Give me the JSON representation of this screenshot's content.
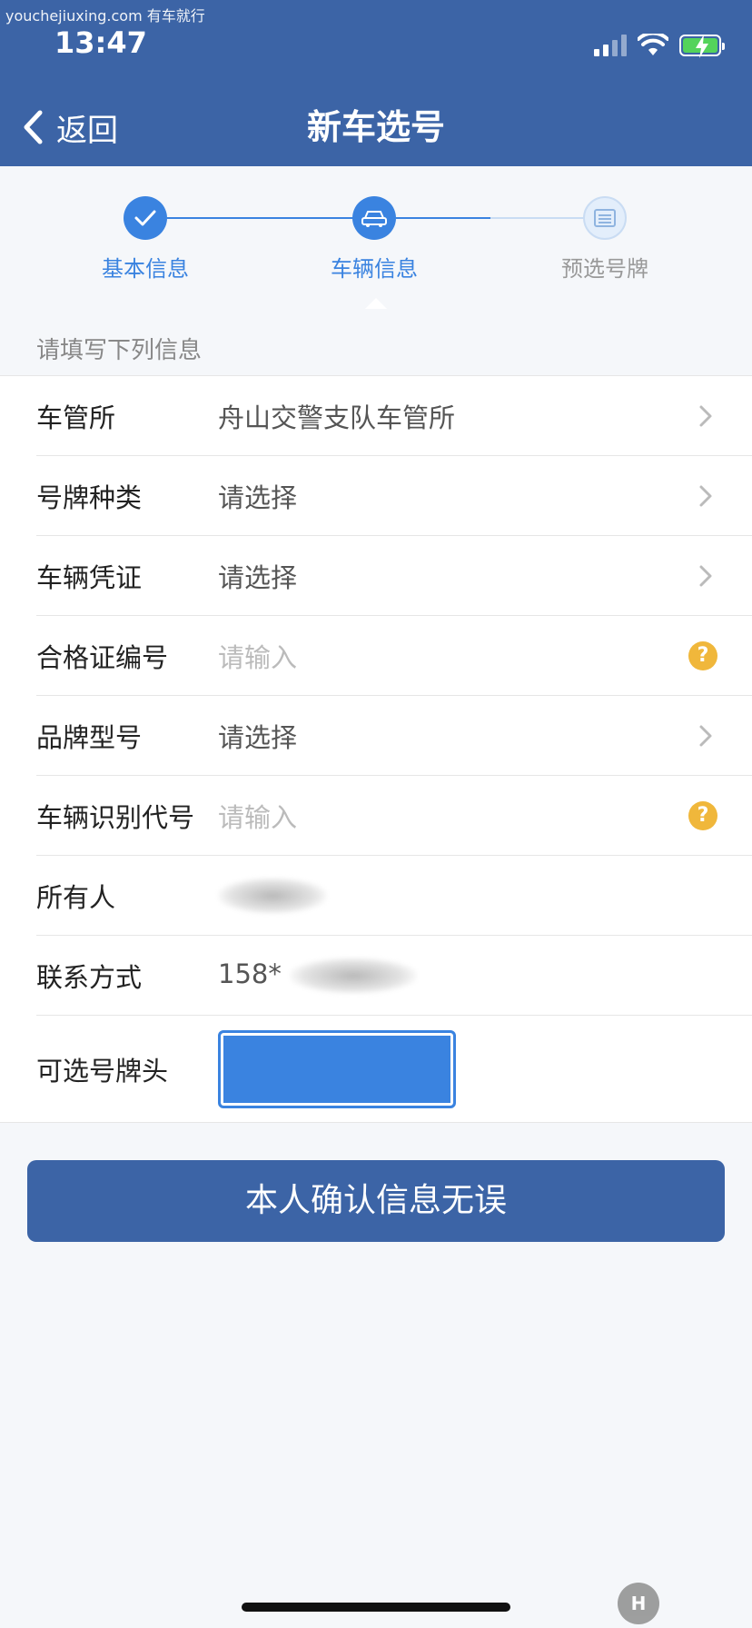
{
  "watermark": "youchejiuxing.com 有车就行",
  "status_bar": {
    "time": "13:47"
  },
  "nav": {
    "back_label": "返回",
    "title": "新车选号"
  },
  "steps": [
    {
      "label": "基本信息",
      "state": "done",
      "icon": "check-icon"
    },
    {
      "label": "车辆信息",
      "state": "active",
      "icon": "car-icon"
    },
    {
      "label": "预选号牌",
      "state": "pending",
      "icon": "plate-icon"
    }
  ],
  "section_tip": "请填写下列信息",
  "form": {
    "rows": [
      {
        "label": "车管所",
        "value": "舟山交警支队车管所",
        "action": "chevron"
      },
      {
        "label": "号牌种类",
        "value": "请选择",
        "action": "chevron"
      },
      {
        "label": "车辆凭证",
        "value": "请选择",
        "action": "chevron"
      },
      {
        "label": "合格证编号",
        "placeholder": "请输入",
        "action": "help"
      },
      {
        "label": "品牌型号",
        "value": "请选择",
        "action": "chevron"
      },
      {
        "label": "车辆识别代号",
        "placeholder": "请输入",
        "action": "help"
      },
      {
        "label": "所有人",
        "value": "",
        "action": "none"
      },
      {
        "label": "联系方式",
        "value": "158*",
        "action": "none"
      },
      {
        "label": "可选号牌头",
        "value": "",
        "action": "select-box"
      }
    ]
  },
  "help_glyph": "?",
  "confirm_button": "本人确认信息无误",
  "colors": {
    "brand": "#3c64a6",
    "step_active": "#3a83e0",
    "help": "#f0b73b",
    "prefix_box": "#3a83e0"
  }
}
